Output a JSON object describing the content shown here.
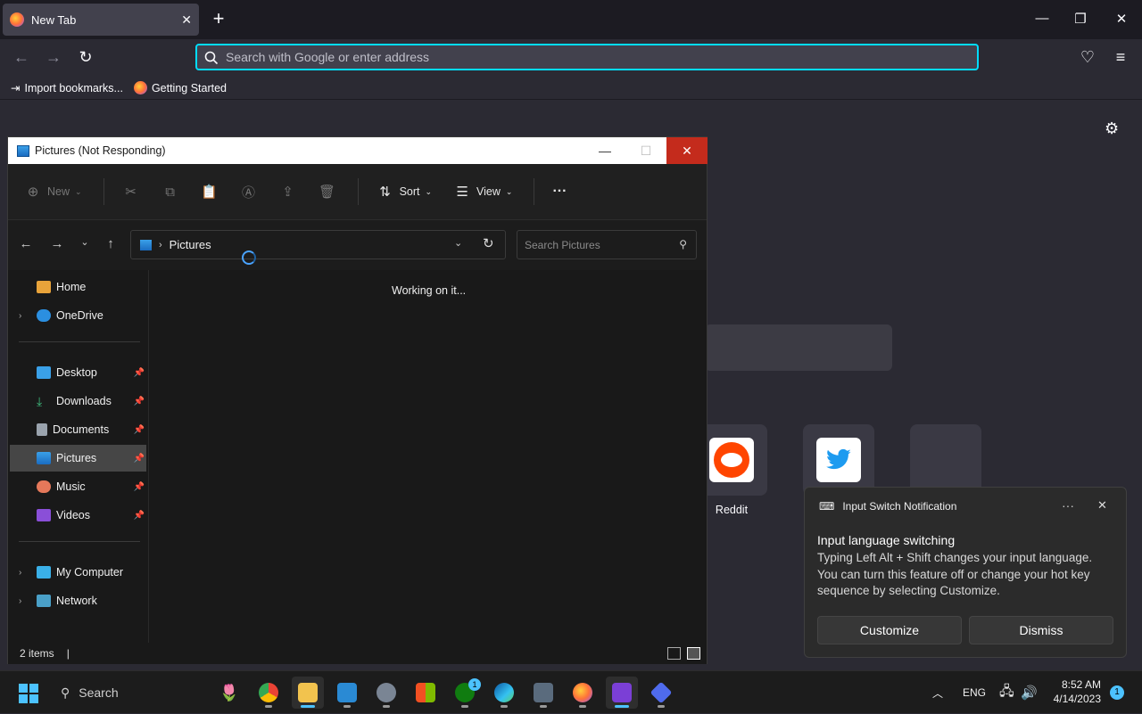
{
  "browser": {
    "tab_title": "New Tab",
    "new_tab_symbol": "+",
    "urlbar_placeholder": "Search with Google or enter address",
    "bookmarks": [
      "Import bookmarks...",
      "Getting Started"
    ]
  },
  "newtab": {
    "shortcuts": [
      {
        "label": "Reddit",
        "icon": "reddit-icon",
        "color": "#ff4500"
      },
      {
        "label": "",
        "icon": "twitter-icon",
        "color": "#1d9bf0"
      },
      {
        "label": "",
        "icon": "empty"
      }
    ]
  },
  "explorer": {
    "title": "Pictures (Not Responding)",
    "toolbar": {
      "new_label": "New",
      "sort_label": "Sort",
      "view_label": "View",
      "more_label": "···"
    },
    "breadcrumb": "Pictures",
    "search_placeholder": "Search Pictures",
    "working_text": "Working on it...",
    "nav": {
      "home": "Home",
      "onedrive": "OneDrive",
      "desktop": "Desktop",
      "downloads": "Downloads",
      "documents": "Documents",
      "pictures": "Pictures",
      "music": "Music",
      "videos": "Videos",
      "my_computer": "My Computer",
      "network": "Network"
    },
    "status": "2 items",
    "status_sep": "|"
  },
  "notification": {
    "app": "Input Switch Notification",
    "title": "Input language switching",
    "body": "Typing Left Alt + Shift changes your input language. You can turn this feature off or change your hot key sequence by selecting Customize.",
    "customize_label": "Customize",
    "dismiss_label": "Dismiss",
    "more": "···",
    "close": "✕"
  },
  "taskbar": {
    "search_label": "Search",
    "lang": "ENG",
    "time": "8:52 AM",
    "date": "4/14/2023",
    "notif_count": "1",
    "xbox_badge": "1"
  },
  "colors": {
    "accent": "#00ddff",
    "win_accent": "#4cc2ff",
    "close_red": "#c42b1c"
  }
}
